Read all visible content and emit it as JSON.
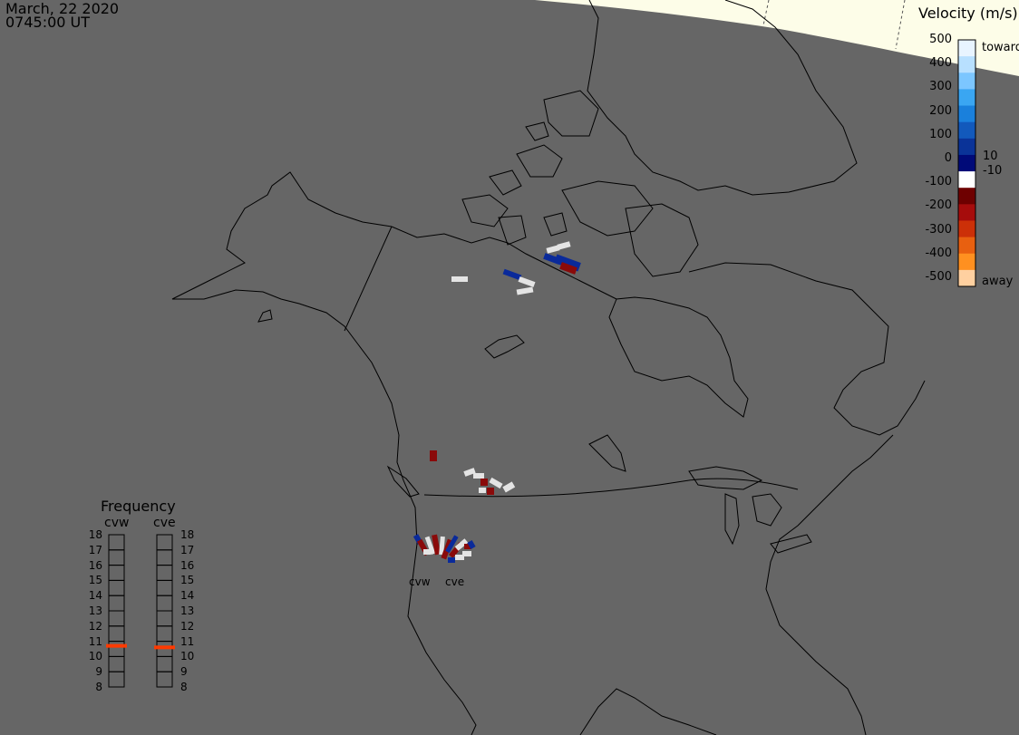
{
  "header": {
    "date": "March, 22 2020",
    "time": "0745:00 UT"
  },
  "velocity_scale": {
    "title": "Velocity (m/s)",
    "ticks": [
      "500",
      "400",
      "300",
      "200",
      "100",
      "0",
      "-100",
      "-200",
      "-300",
      "-400",
      "-500"
    ],
    "inner_labels": [
      "10",
      "-10"
    ],
    "toward_label": "toward",
    "away_label": "away",
    "colors": [
      "#e8f4ff",
      "#b8e0ff",
      "#7cc6ff",
      "#3aa6f2",
      "#1a80dc",
      "#1259bc",
      "#0a3398",
      "#000a78",
      "#ffffff",
      "#6e0000",
      "#a60c0c",
      "#cc3008",
      "#e86010",
      "#ff9020",
      "#ffd0a0"
    ]
  },
  "frequency": {
    "title": "Frequency",
    "radars": [
      {
        "name": "cvw",
        "value": 10.7
      },
      {
        "name": "cve",
        "value": 10.6
      }
    ],
    "ticks": [
      "18",
      "17",
      "16",
      "15",
      "14",
      "13",
      "12",
      "11",
      "10",
      "9",
      "8"
    ]
  },
  "map": {
    "radar_labels": [
      "cvw",
      "cve"
    ],
    "colors": {
      "background": "#666666",
      "daylight": "#fdfde8",
      "coast": "#000000",
      "scatter_white": "#e4e4e4",
      "scatter_blue": "#0a2a9a",
      "scatter_red": "#8a0a0a"
    }
  }
}
